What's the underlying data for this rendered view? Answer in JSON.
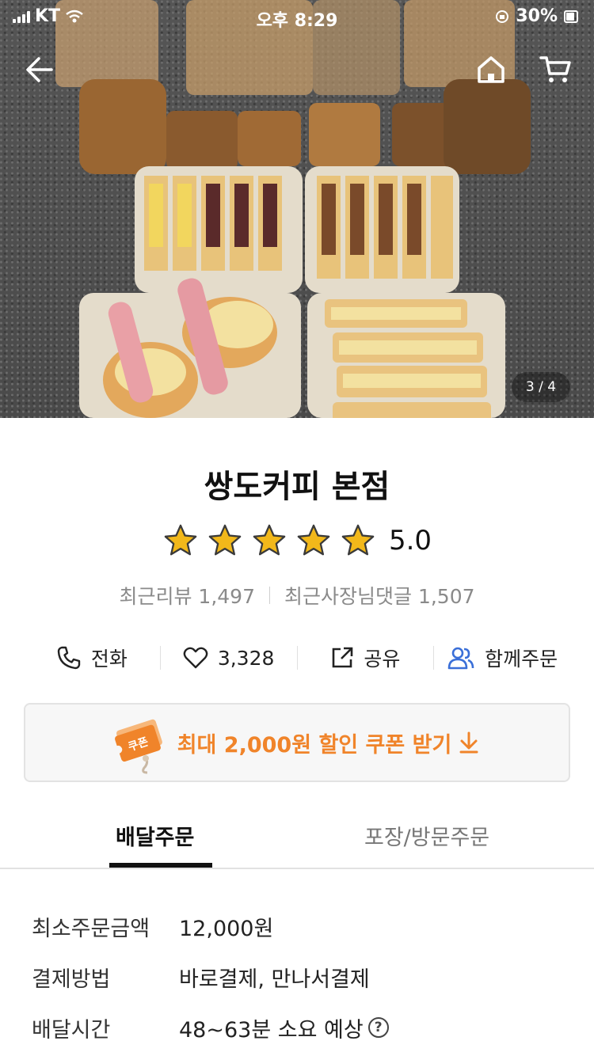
{
  "status_bar": {
    "carrier": "KT",
    "time": "오후 8:29",
    "battery": "30%"
  },
  "hero": {
    "pager": "3 / 4"
  },
  "store": {
    "name": "쌍도커피 본점",
    "rating": "5.0",
    "stars_filled": 5,
    "recent_reviews": "최근리뷰 1,497",
    "recent_owner_replies": "최근사장님댓글 1,507"
  },
  "actions": {
    "call": "전화",
    "likes": "3,328",
    "share": "공유",
    "group_order": "함께주문"
  },
  "coupon": {
    "icon_label": "쿠폰",
    "text": "최대 2,000원 할인 쿠폰 받기"
  },
  "tabs": {
    "delivery": "배달주문",
    "pickup": "포장/방문주문"
  },
  "info": [
    {
      "label": "최소주문금액",
      "value": "12,000원"
    },
    {
      "label": "결제방법",
      "value": "바로결제, 만나서결제"
    },
    {
      "label": "배달시간",
      "value": "48~63분 소요 예상"
    }
  ],
  "colors": {
    "accent": "#f0842a",
    "star": "#f2b81a",
    "text": "#222222"
  }
}
